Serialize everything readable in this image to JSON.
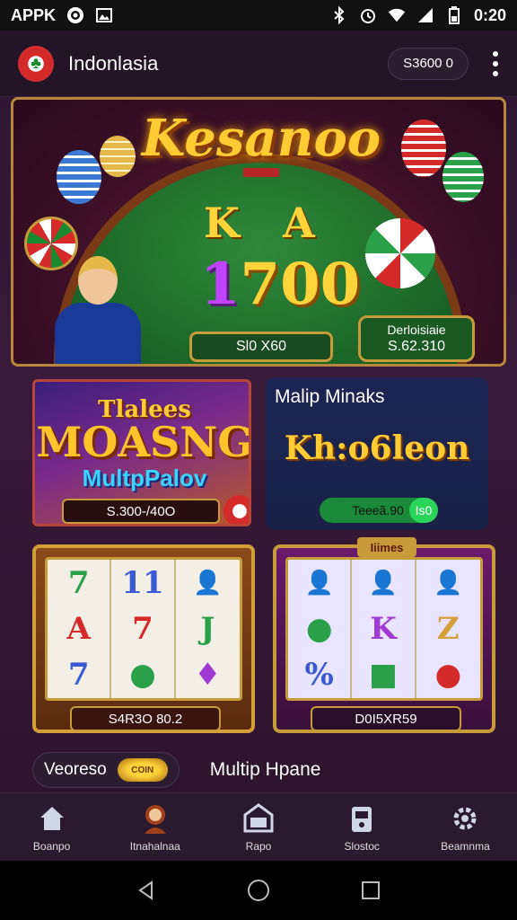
{
  "statusbar": {
    "carrier": "APPK",
    "time": "0:20",
    "icons": [
      "app-notification-icon",
      "image-icon",
      "bluetooth-icon",
      "alarm-icon",
      "wifi-icon",
      "signal-icon",
      "battery-icon"
    ]
  },
  "header": {
    "title": "Indonlasia",
    "balance": "S3600 0",
    "logo_icon": "app-logo-icon",
    "menu_icon": "more-vert-icon"
  },
  "hero": {
    "title": "Kesanoo",
    "card_k": "K",
    "card_a": "A",
    "amount_main": "1",
    "amount_rest": "700",
    "pill_left": "Sl0 X60",
    "pill_right_label": "Derloisiaie",
    "pill_right_value": "S.62.310"
  },
  "game1": {
    "title_line1": "Tlalees",
    "title_line2": "MOASNG",
    "title_line3": "MultpPalov",
    "amount": "S.300-/40O"
  },
  "game2": {
    "heading": "Malip Minaks",
    "brand": "Kh:o6leon",
    "pill": "Teeeã.90",
    "pill_btn": "Is0"
  },
  "slot1": {
    "symbols": [
      "7",
      "11",
      "👤",
      "A",
      "7",
      "J",
      "7",
      "●",
      "♦"
    ],
    "amount": "S4R3O 80.2"
  },
  "slot2": {
    "badge": "Iiimes",
    "symbols": [
      "👤",
      "👤",
      "👤",
      "●",
      "K",
      "Z",
      "%",
      "■",
      "●"
    ],
    "amount": "D0I5XR59"
  },
  "promo": {
    "left_label": "Veoreso",
    "coin_label": "COIN",
    "right_text": "Multip Hpane"
  },
  "nav": {
    "items": [
      {
        "label": "Boanpo",
        "icon": "home-icon"
      },
      {
        "label": "Itnahalnaa",
        "icon": "profile-avatar-icon"
      },
      {
        "label": "Rapo",
        "icon": "tv-icon"
      },
      {
        "label": "Slostoc",
        "icon": "slots-icon"
      },
      {
        "label": "Beamnma",
        "icon": "settings-gear-icon"
      }
    ]
  },
  "colors": {
    "accent_gold": "#ffcc33",
    "background": "#2a1530",
    "table_green": "#1e6a2a"
  }
}
